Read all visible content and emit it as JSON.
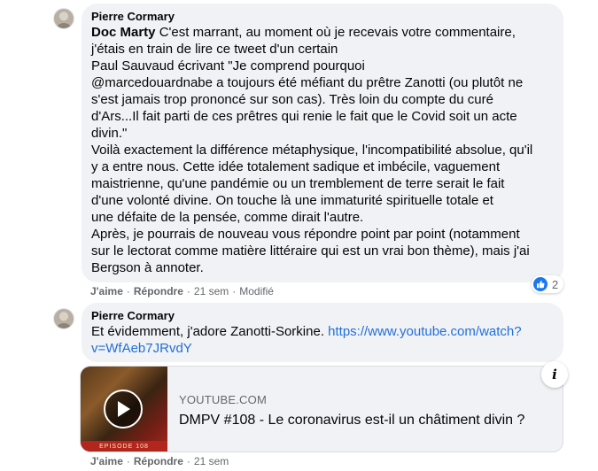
{
  "comment1": {
    "author": "Pierre Cormary",
    "mention": "Doc Marty",
    "text": " C'est marrant, au moment où je recevais votre commentaire,\nj'étais en train de lire ce tweet d'un certain\nPaul Sauvaud écrivant \"Je comprend pourquoi\n@marcedouardnabe a toujours été méfiant du prêtre Zanotti (ou plutôt ne\ns'est jamais trop prononcé sur son cas). Très loin du compte du curé\nd'Ars...Il fait parti de ces prêtres qui renie le fait que le Covid soit un acte\ndivin.\"\nVoilà exactement la différence métaphysique, l'incompatibilité absolue, qu'il\ny a entre nous. Cette idée totalement sadique et imbécile, vaguement\nmaistrienne, qu'une pandémie ou un tremblement de terre serait le fait\nd'une volonté divine. On touche là une immaturité spirituelle totale et\nune défaite de la pensée, comme dirait l'autre.\nAprès, je pourrais de nouveau vous répondre point par point (notamment\nsur le lectorat comme matière littéraire qui est un vrai bon thème), mais j'ai\nBergson à annoter.",
    "like": "J'aime",
    "reply": "Répondre",
    "time": "21 sem",
    "edited": "Modifié",
    "reaction_count": "2"
  },
  "comment2": {
    "author": "Pierre Cormary",
    "text": "Et évidemment, j'adore Zanotti-Sorkine. ",
    "link": "https://www.youtube.com/watch?\nv=WfAeb7JRvdY",
    "like": "J'aime",
    "reply": "Répondre",
    "time": "21 sem"
  },
  "link_card": {
    "domain": "YOUTUBE.COM",
    "title": "DMPV #108 - Le coronavirus est-il un châtiment divin ?",
    "thumb_band": "EPISODE 108"
  },
  "icons": {
    "info": "i",
    "like": "like-icon",
    "play": "play-icon"
  },
  "colors": {
    "bubble": "#f0f2f5",
    "link": "#216fdb",
    "like": "#1877f2",
    "meta": "#65676b"
  }
}
